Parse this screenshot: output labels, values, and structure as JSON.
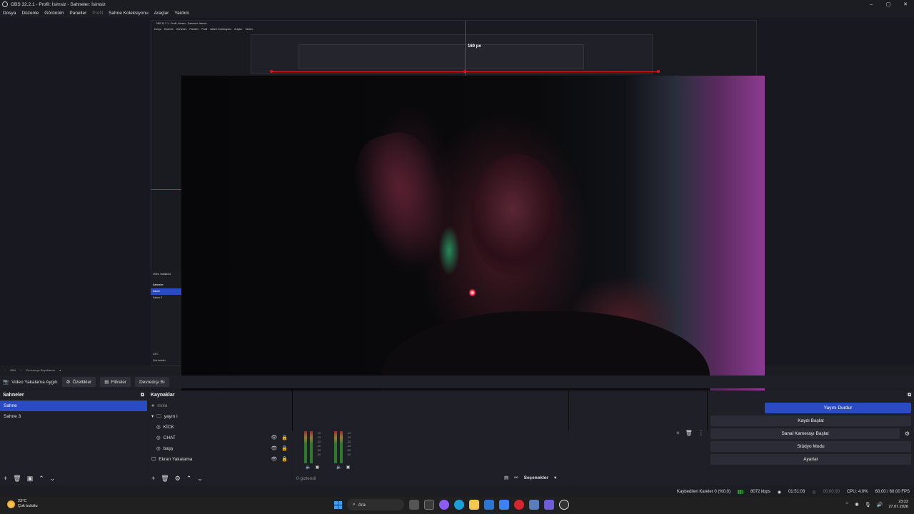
{
  "window": {
    "title": "OBS 32.2.1 - Profil: İsimsiz - Sahneler: İsimsiz",
    "controls": [
      "–",
      "▢",
      "✕"
    ]
  },
  "menu": {
    "items": [
      "Dosya",
      "Düzenle",
      "Görünüm",
      "Paneller",
      "Profil",
      "Sahne Koleksiyonu",
      "Araçlar",
      "Yardım"
    ]
  },
  "preview": {
    "measure_label": "160 px",
    "nested_title": "OBS 32.2.1 - Profil: İsimsiz - Sahneler: İsimsiz",
    "nested_menu": [
      "Dosya",
      "Düzenle",
      "Görünüm",
      "Paneller",
      "Profil",
      "Sahne Koleksiyonu",
      "Araçlar",
      "Yardım"
    ],
    "mini_panel": {
      "source": "Video Yakalama",
      "header": "Sahneler",
      "scenes": [
        "Sahne",
        "Sahne 3"
      ],
      "weather_temp": "23°C",
      "weather_desc": "Çok bulutlu"
    }
  },
  "zoom_bar": {
    "zoom": "88%",
    "fit_label": "Pencereye Boyutlandır"
  },
  "context_bar": {
    "source_label": "Video Yakalama Aygıtı",
    "properties": "Özellikler",
    "filters": "Filtreler",
    "deactivate": "Devredışı Bı"
  },
  "scenes": {
    "header": "Sahneler",
    "items": [
      "Sahne",
      "Sahne 3"
    ]
  },
  "sources": {
    "header": "Kaynaklar",
    "items": [
      "mola",
      "yayın i",
      "KİCK",
      "CHAT",
      "başş",
      "Ekran Yakalama"
    ]
  },
  "mixer": {
    "scale": [
      "-10",
      "-20",
      "-30",
      "-40",
      "-50",
      "-60"
    ],
    "hidden_label": "0 gizlendi",
    "options_label": "Seçenekler"
  },
  "controls": {
    "stop_stream": "Yayını Durdur",
    "start_record": "Kaydı Başlat",
    "virtual_cam": "Sanal Kamerayı Başlat",
    "studio_mode": "Stüdyo Modu",
    "settings": "Ayarlar"
  },
  "status": {
    "dropped_frames": "Kaybedilen Kareler 0 (%0.0)",
    "bitrate": "8072 kbps",
    "stream_time": "01:51:03",
    "record_time": "00:00:00",
    "cpu": "CPU: 4.0%",
    "fps": "60.00 / 60.00 FPS"
  },
  "taskbar": {
    "weather_temp": "23°C",
    "weather_desc": "Çok bulutlu",
    "search": "Ara",
    "time": "23:22",
    "date": "27.07.2026"
  },
  "colors": {
    "accent": "#2a4bc4",
    "guide_red": "#e0141e"
  }
}
